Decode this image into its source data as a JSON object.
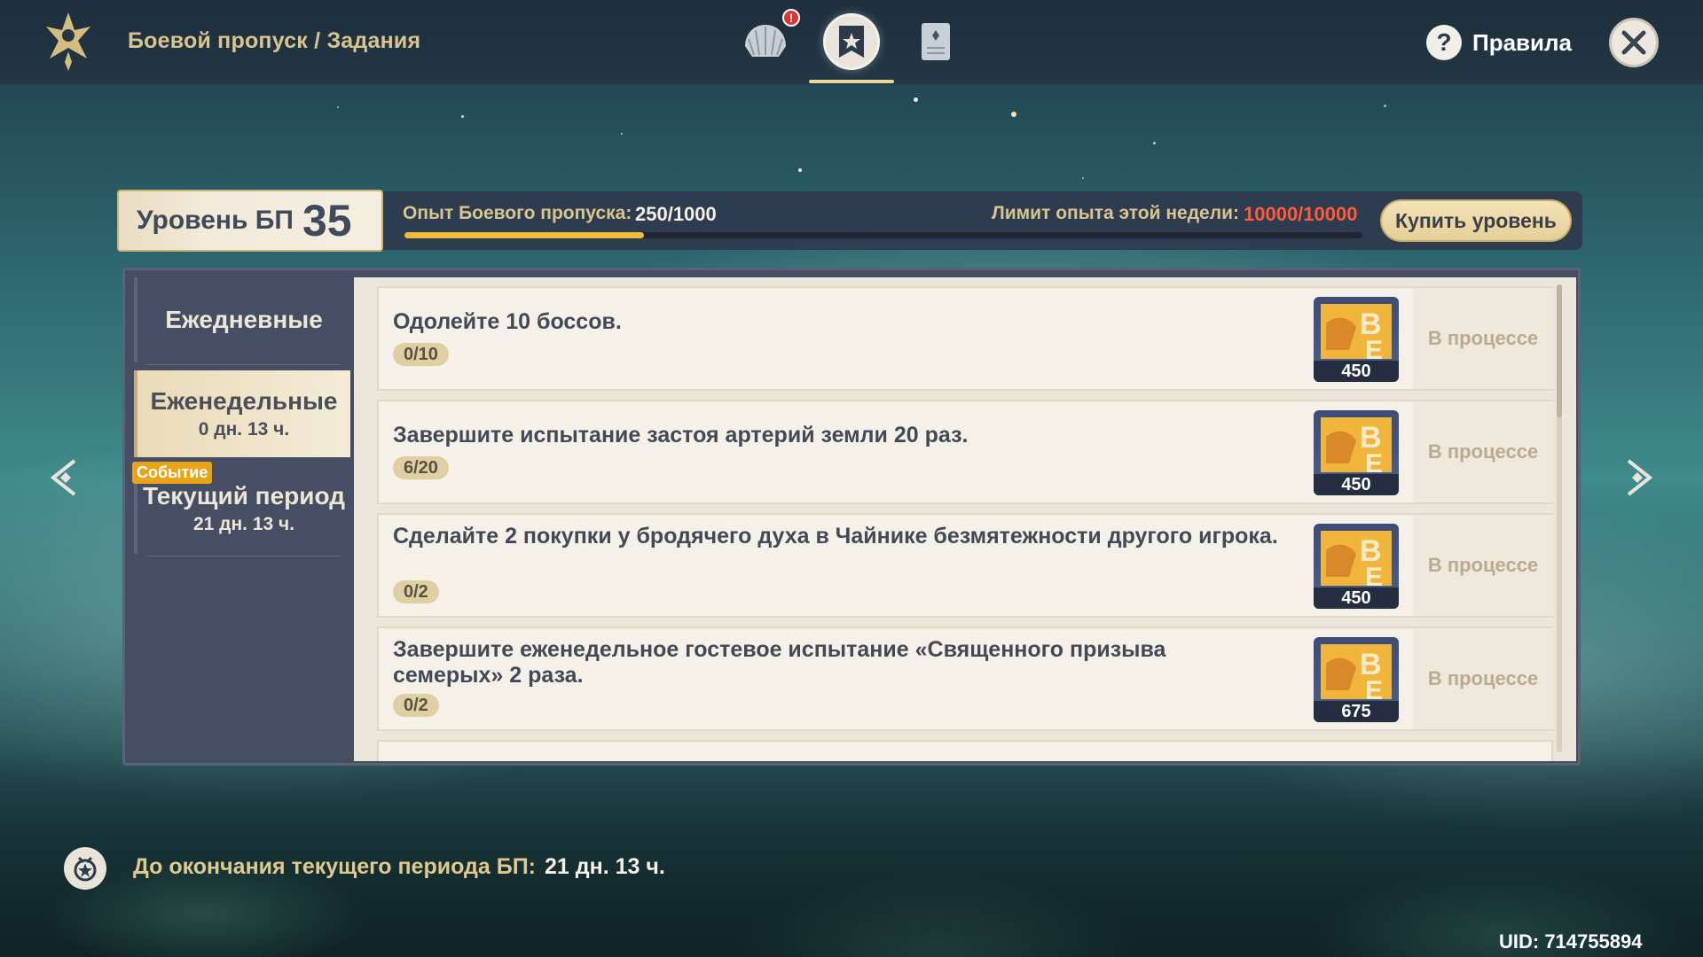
{
  "header": {
    "breadcrumb": "Боевой пропуск / Задания",
    "tabs": [
      {
        "icon": "shell-icon",
        "notification": "!"
      },
      {
        "icon": "banner-icon",
        "active": true
      },
      {
        "icon": "scroll-icon"
      }
    ],
    "help_label": "Правила",
    "help_glyph": "?"
  },
  "level": {
    "label": "Уровень БП",
    "value": "35",
    "exp_label": "Опыт Боевого пропуска:",
    "exp_value": "250/1000",
    "exp_fraction": 0.25,
    "week_limit_label": "Лимит опыта этой недели:",
    "week_limit_value": "10000/10000",
    "buy_label": "Купить уровень"
  },
  "sidebar": {
    "daily": {
      "title": "Ежедневные"
    },
    "weekly": {
      "title": "Еженедельные",
      "sub": "0 дн. 13 ч."
    },
    "period": {
      "badge": "Событие",
      "title": "Текущий период",
      "sub": "21 дн. 13 ч."
    }
  },
  "quests": [
    {
      "text": "Одолейте 10 боссов.",
      "progress": "0/10",
      "reward": "450",
      "status": "В процессе"
    },
    {
      "text": "Завершите испытание застоя артерий земли 20 раз.",
      "progress": "6/20",
      "reward": "450",
      "status": "В процессе"
    },
    {
      "text": "Сделайте 2 покупки у бродячего духа в Чайнике безмятежности другого игрока.",
      "progress": "0/2",
      "reward": "450",
      "status": "В процессе"
    },
    {
      "text": "Завершите еженедельное гостевое испытание «Священного призыва семерых» 2 раза.",
      "progress": "0/2",
      "reward": "675",
      "status": "В процессе"
    }
  ],
  "footer": {
    "label": "До окончания текущего периода БП:",
    "value": "21 дн. 13 ч.",
    "uid": "UID: 714755894"
  },
  "colors": {
    "accent_gold": "#d9c48f",
    "limit_red": "#ff5a3a",
    "progress_fill": "#f0bb3a"
  }
}
